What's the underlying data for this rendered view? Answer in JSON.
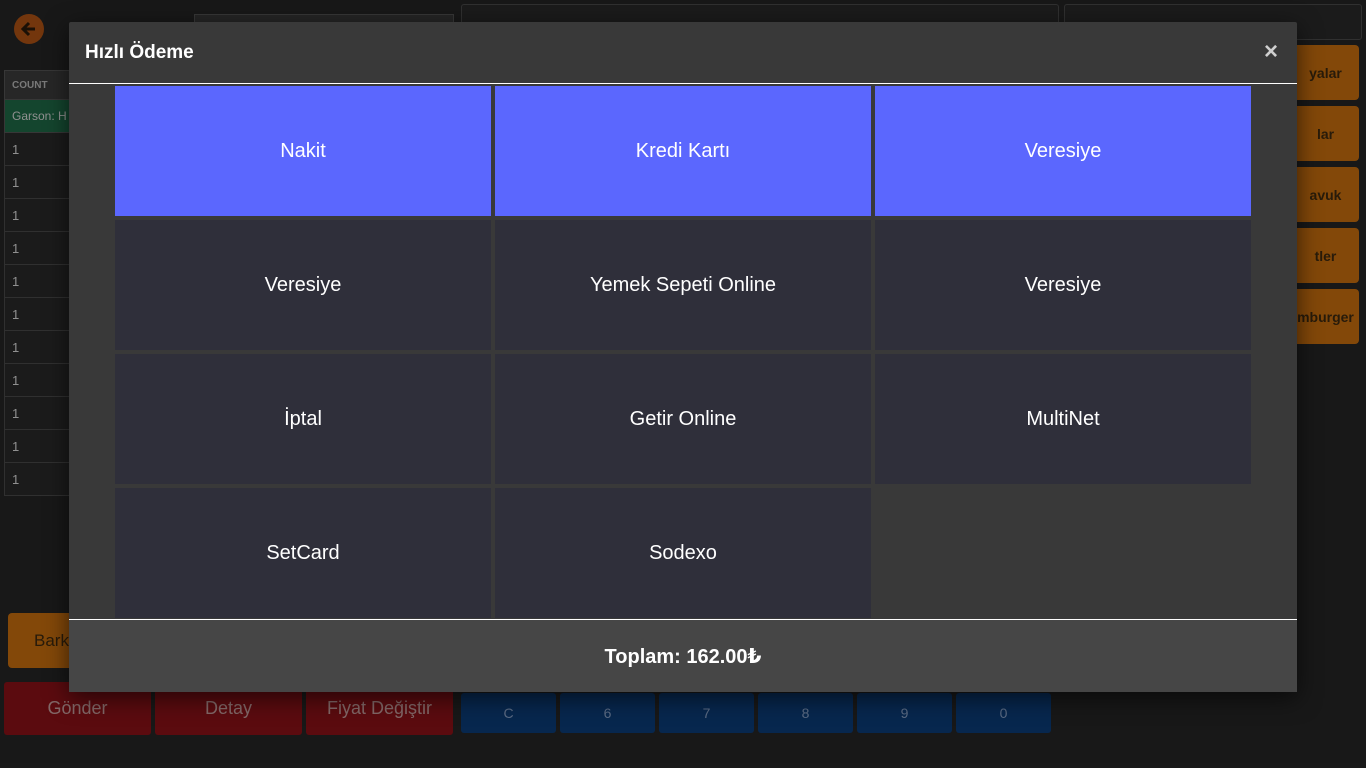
{
  "background": {
    "order_table": {
      "header": "COUNT",
      "waiter": "Garson: H",
      "rows": [
        "1",
        "1",
        "1",
        "1",
        "1",
        "1",
        "1",
        "1",
        "1",
        "1",
        "1"
      ]
    },
    "category_buttons": [
      "yalar",
      "lar",
      "avuk",
      "tler",
      "mburger"
    ],
    "bark_label": "Bark",
    "action_buttons": [
      "Gönder",
      "Detay",
      "Fiyat Değiştir"
    ],
    "number_buttons": [
      "C",
      "6",
      "7",
      "8",
      "9",
      "0"
    ]
  },
  "modal": {
    "title": "Hızlı Ödeme",
    "close_glyph": "×",
    "payment_options": [
      {
        "label": "Nakit",
        "highlighted": true
      },
      {
        "label": "Kredi Kartı",
        "highlighted": true
      },
      {
        "label": "Veresiye",
        "highlighted": true
      },
      {
        "label": "Veresiye",
        "highlighted": false
      },
      {
        "label": "Yemek Sepeti Online",
        "highlighted": false
      },
      {
        "label": "Veresiye",
        "highlighted": false
      },
      {
        "label": "İptal",
        "highlighted": false
      },
      {
        "label": "Getir Online",
        "highlighted": false
      },
      {
        "label": "MultiNet",
        "highlighted": false
      },
      {
        "label": "SetCard",
        "highlighted": false
      },
      {
        "label": "Sodexo",
        "highlighted": false
      }
    ],
    "total": "Toplam: 162.00₺"
  },
  "colors": {
    "highlight": "#5b67fe",
    "option_default": "#2f2f3a",
    "modal_bg": "#393939",
    "category_orange": "#c96f0e",
    "action_red": "#8c1217",
    "numpad_blue": "#0c3d79"
  },
  "icons": {
    "back": "arrow-left-icon",
    "close": "close-icon"
  }
}
